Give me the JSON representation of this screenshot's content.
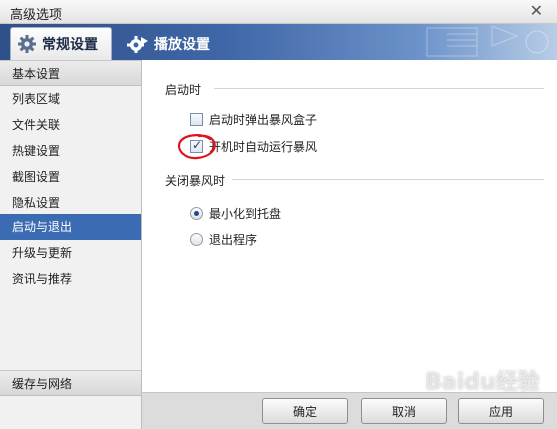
{
  "window": {
    "title": "高级选项",
    "close_icon": "close-icon"
  },
  "tabs": [
    {
      "label": "常规设置",
      "icon": "gear-icon",
      "active": true
    },
    {
      "label": "播放设置",
      "icon": "play-gear-icon",
      "active": false
    }
  ],
  "sidebar": {
    "items": [
      {
        "label": "基本设置"
      },
      {
        "label": "列表区域"
      },
      {
        "label": "文件关联"
      },
      {
        "label": "热键设置"
      },
      {
        "label": "截图设置"
      },
      {
        "label": "隐私设置"
      },
      {
        "label": "启动与退出",
        "active": true
      },
      {
        "label": "升级与更新"
      },
      {
        "label": "资讯与推荐"
      }
    ],
    "footer_item": {
      "label": "缓存与网络"
    }
  },
  "content": {
    "startup": {
      "title": "启动时",
      "options": [
        {
          "label": "启动时弹出暴风盒子",
          "checked": false
        },
        {
          "label": "开机时自动运行暴风",
          "checked": true
        }
      ]
    },
    "close": {
      "title": "关闭暴风时",
      "options": [
        {
          "label": "最小化到托盘",
          "selected": true
        },
        {
          "label": "退出程序",
          "selected": false
        }
      ]
    }
  },
  "buttons": {
    "ok": "确定",
    "cancel": "取消",
    "apply": "应用"
  },
  "watermark": "Baidu经验",
  "colors": {
    "accent": "#3b6cb3",
    "tab_bar": "#3f66a6",
    "annotation": "#e0121b"
  }
}
